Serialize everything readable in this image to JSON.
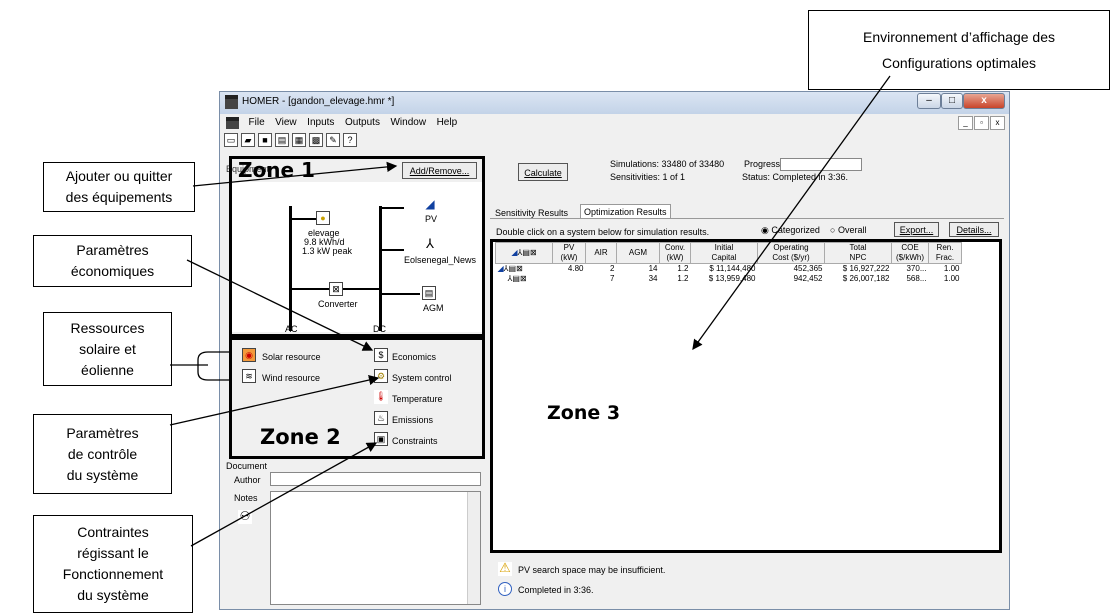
{
  "window": {
    "title": "HOMER - [gandon_elevage.hmr *]",
    "menu": [
      "File",
      "View",
      "Inputs",
      "Outputs",
      "Window",
      "Help"
    ]
  },
  "zone1": {
    "title": "Zone 1",
    "equipment_label": "Equipment",
    "add_remove": "Add/Remove...",
    "load_name": "elevage",
    "load_kwh": "9.8 kWh/d",
    "load_peak": "1.3 kW peak",
    "pv": "PV",
    "wind": "Eolsenegal_News",
    "converter": "Converter",
    "agm": "AGM",
    "ac": "AC",
    "dc": "DC"
  },
  "zone2": {
    "title": "Zone 2",
    "left_items": [
      "Solar resource",
      "Wind resource"
    ],
    "right_items": [
      "Economics",
      "System control",
      "Temperature",
      "Emissions",
      "Constraints"
    ]
  },
  "document": {
    "label": "Document",
    "author": "Author",
    "notes": "Notes"
  },
  "sim": {
    "calculate": "Calculate",
    "simulations": "Simulations:  33480 of 33480",
    "progress": "Progress:",
    "sensitivities": "Sensitivities: 1 of 1",
    "status": "Status:    Completed in 3:36."
  },
  "tabs": [
    "Sensitivity Results",
    "Optimization Results"
  ],
  "results": {
    "hint": "Double click on a system below for simulation results.",
    "categorized": "Categorized",
    "overall": "Overall",
    "export": "Export...",
    "details": "Details...",
    "headers": [
      "PV\n(kW)",
      "AIR",
      "AGM",
      "Conv.\n(kW)",
      "Initial\nCapital",
      "Operating\nCost ($/yr)",
      "Total\nNPC",
      "COE\n($/kWh)",
      "Ren.\nFrac."
    ],
    "rows": [
      [
        "4.80",
        "2",
        "14",
        "1.2",
        "$ 11,144,480",
        "452,365",
        "$ 16,927,222",
        "370...",
        "1.00"
      ],
      [
        "",
        "7",
        "34",
        "1.2",
        "$ 13,959,480",
        "942,452",
        "$ 26,007,182",
        "568...",
        "1.00"
      ]
    ]
  },
  "zone3": {
    "title": "Zone 3"
  },
  "messages": [
    "PV search space may be insufficient.",
    "Completed in 3:36."
  ],
  "callouts": {
    "env": [
      "Environnement d’affichage des",
      "Configurations optimales"
    ],
    "add": [
      "Ajouter ou quitter",
      "des équipements"
    ],
    "eco": [
      "Paramètres",
      "économiques"
    ],
    "res": [
      "Ressources",
      "solaire et",
      "éolienne"
    ],
    "ctrl": [
      "Paramètres",
      "de contrôle",
      "du système"
    ],
    "constr": [
      "Contraintes",
      "régissant le",
      "Fonctionnement",
      "du système"
    ]
  }
}
